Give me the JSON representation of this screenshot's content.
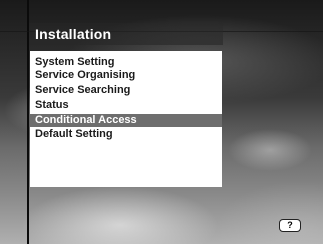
{
  "header": {
    "title": "Installation"
  },
  "menu": {
    "items": [
      {
        "label": "System Setting",
        "selected": false
      },
      {
        "label": "Service Organising",
        "selected": false
      },
      {
        "label": "Service Searching",
        "selected": false
      },
      {
        "label": "Status",
        "selected": false
      },
      {
        "label": "Conditional Access",
        "selected": true
      },
      {
        "label": "Default Setting",
        "selected": false
      }
    ]
  },
  "footer": {
    "help_label": "?"
  },
  "colors": {
    "selected_background": "#6e6e6e",
    "panel_background": "#ffffff",
    "title_text": "#ffffff"
  },
  "icons": {
    "help": "help-icon"
  }
}
